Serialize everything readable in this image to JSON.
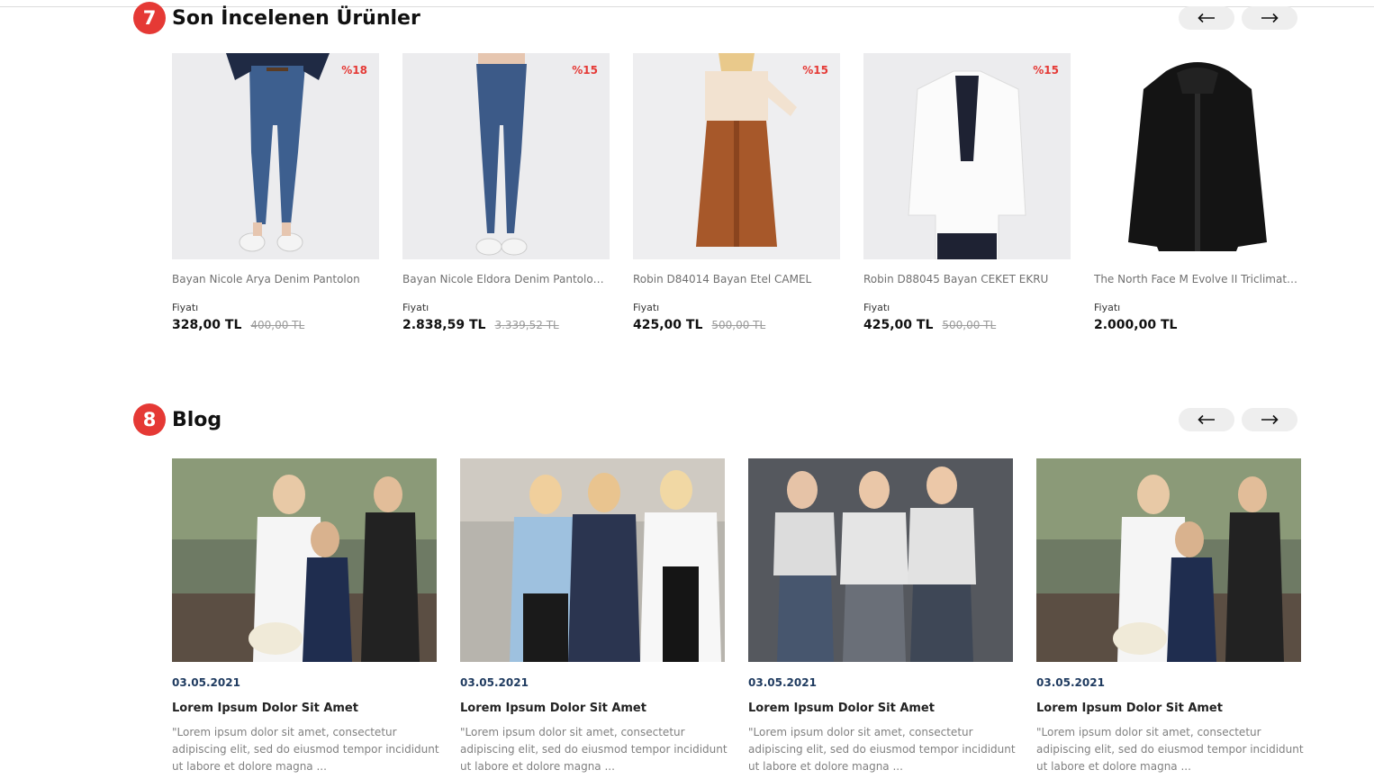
{
  "recent": {
    "badge": "7",
    "title": "Son İncelenen Ürünler",
    "prev_icon": "arrow-left-icon",
    "next_icon": "arrow-right-icon",
    "products": [
      {
        "name": "Bayan Nicole Arya Denim Pantolon",
        "discount": "%18",
        "price_label": "Fiyatı",
        "price": "328,00 TL",
        "old_price": "400,00 TL"
      },
      {
        "name": "Bayan Nicole Eldora Denim Pantolon K...",
        "discount": "%15",
        "price_label": "Fiyatı",
        "price": "2.838,59 TL",
        "old_price": "3.339,52 TL"
      },
      {
        "name": "Robin D84014 Bayan Etel CAMEL",
        "discount": "%15",
        "price_label": "Fiyatı",
        "price": "425,00 TL",
        "old_price": "500,00 TL"
      },
      {
        "name": "Robin D88045 Bayan CEKET EKRU",
        "discount": "%15",
        "price_label": "Fiyatı",
        "price": "425,00 TL",
        "old_price": "500,00 TL"
      },
      {
        "name": "The North Face M Evolve II Triclimate ...",
        "discount": "",
        "price_label": "Fiyatı",
        "price": "2.000,00 TL",
        "old_price": ""
      }
    ]
  },
  "blog": {
    "badge": "8",
    "title": "Blog",
    "posts": [
      {
        "date": "03.05.2021",
        "title": "Lorem Ipsum Dolor Sit Amet",
        "excerpt": "\"Lorem ipsum dolor sit amet, consectetur adipiscing elit, sed do eiusmod tempor incididunt ut labore et dolore magna ..."
      },
      {
        "date": "03.05.2021",
        "title": "Lorem Ipsum Dolor Sit Amet",
        "excerpt": "\"Lorem ipsum dolor sit amet, consectetur adipiscing elit, sed do eiusmod tempor incididunt ut labore et dolore magna ..."
      },
      {
        "date": "03.05.2021",
        "title": "Lorem Ipsum Dolor Sit Amet",
        "excerpt": "\"Lorem ipsum dolor sit amet, consectetur adipiscing elit, sed do eiusmod tempor incididunt ut labore et dolore magna ..."
      },
      {
        "date": "03.05.2021",
        "title": "Lorem Ipsum Dolor Sit Amet",
        "excerpt": "\"Lorem ipsum dolor sit amet, consectetur adipiscing elit, sed do eiusmod tempor incididunt ut labore et dolore magna ..."
      }
    ]
  },
  "colors": {
    "accent": "#e53935",
    "date": "#1e3a5f",
    "discount": "#e53935"
  }
}
